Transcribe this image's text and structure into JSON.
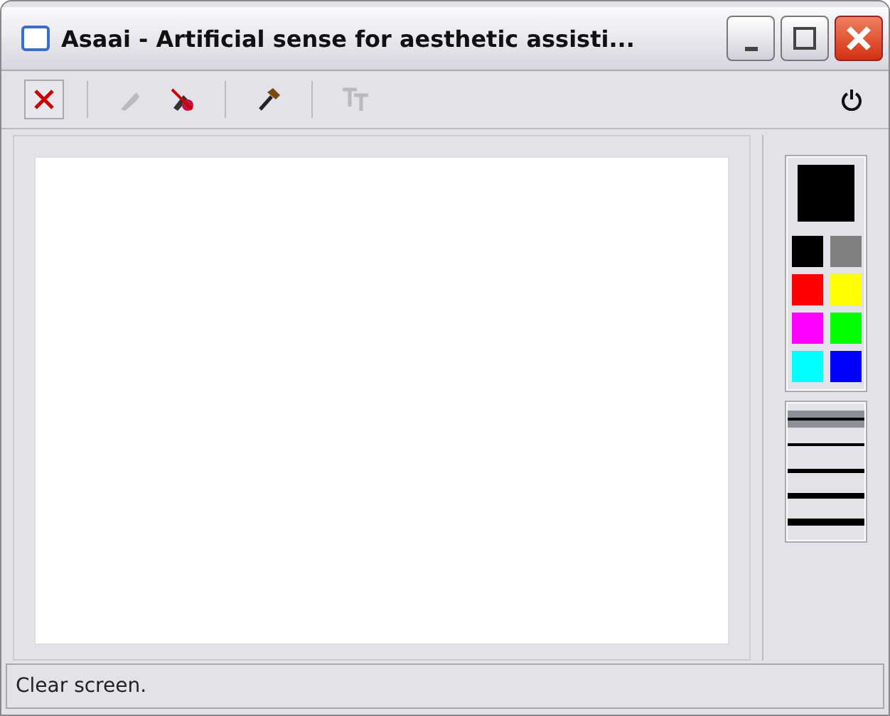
{
  "window": {
    "title": "Asaai - Artificial sense for aesthetic assisti..."
  },
  "toolbar": [
    [
      {
        "kind": "clear",
        "disabled": false
      }
    ],
    [
      {
        "kind": "pen",
        "disabled": true
      },
      {
        "kind": "eraser",
        "disabled": false
      }
    ],
    [
      {
        "kind": "hammer",
        "disabled": false
      }
    ],
    [
      {
        "kind": "text",
        "disabled": true
      }
    ]
  ],
  "current": {
    "color": "#000000"
  },
  "palette": [
    {
      "color": "#000000"
    },
    {
      "color": "#808080"
    },
    {
      "color": "#ff0000"
    },
    {
      "color": "#ffff00"
    },
    {
      "color": "#ff00ff"
    },
    {
      "color": "#00ff00"
    },
    {
      "color": "#00ffff"
    },
    {
      "color": "#0000ff"
    }
  ],
  "line_widths": [
    {
      "selected": true
    },
    {
      "selected": false
    },
    {
      "selected": false
    },
    {
      "selected": false
    },
    {
      "selected": false
    }
  ],
  "status_bar": "Clear screen."
}
